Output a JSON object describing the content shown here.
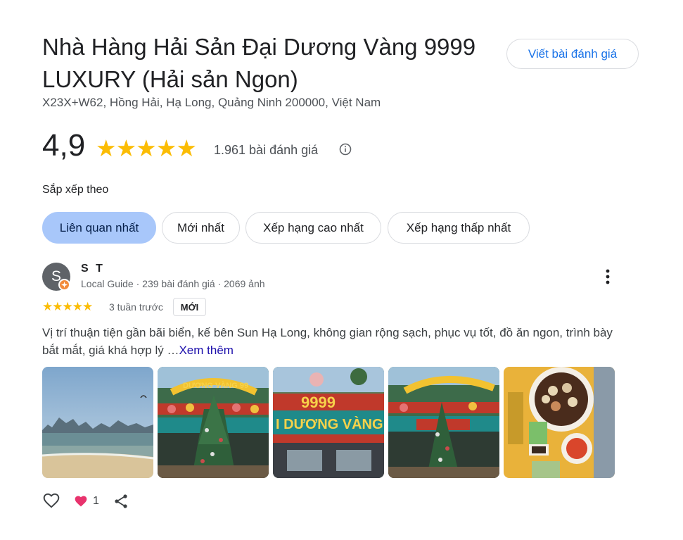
{
  "place": {
    "title": "Nhà Hàng Hải Sản Đại Dương Vàng 9999 LUXURY (Hải sản Ngon)",
    "address": "X23X+W62, Hồng Hải, Hạ Long, Quảng Ninh 200000, Việt Nam",
    "write_review_label": "Viết bài đánh giá",
    "rating": "4,9",
    "stars": "★★★★★",
    "review_count": "1.961 bài đánh giá"
  },
  "sort": {
    "label": "Sắp xếp theo",
    "chips": [
      {
        "label": "Liên quan nhất",
        "active": true
      },
      {
        "label": "Mới nhất",
        "active": false
      },
      {
        "label": "Xếp hạng cao nhất",
        "active": false
      },
      {
        "label": "Xếp hạng thấp nhất",
        "active": false
      }
    ]
  },
  "review": {
    "avatar_letter": "S",
    "name": "S T",
    "meta": "Local Guide · 239 bài đánh giá · 2069 ảnh",
    "stars": "★★★★★",
    "time": "3 tuần trước",
    "badge": "MỚI",
    "text": "Vị trí thuận tiện gần bãi biển, kế bên Sun Hạ Long, không gian rộng sạch, phục vụ tốt, đồ ăn ngon, trình bày bắt mắt, giá khá hợp lý …",
    "more_link": "Xem thêm",
    "photos": [
      {
        "name": "photo-beach-bay"
      },
      {
        "name": "photo-restaurant-front-tree"
      },
      {
        "name": "photo-restaurant-sign-9999"
      },
      {
        "name": "photo-restaurant-front-tree-2"
      },
      {
        "name": "photo-seafood-dish"
      }
    ],
    "sign_text_1": "DƯƠNG VÀNG 99",
    "sign_text_2": "9999",
    "sign_text_3": "I DƯƠNG VÀNG",
    "like_count": "1"
  },
  "colors": {
    "star": "#fbbc04",
    "accent": "#1a73e8",
    "active_chip": "#a8c7fa",
    "heart": "#e8336d"
  },
  "icons": [
    "info-icon",
    "more-vert-icon",
    "heart-outline-icon",
    "heart-filled-icon",
    "share-icon",
    "local-guide-badge-icon"
  ]
}
